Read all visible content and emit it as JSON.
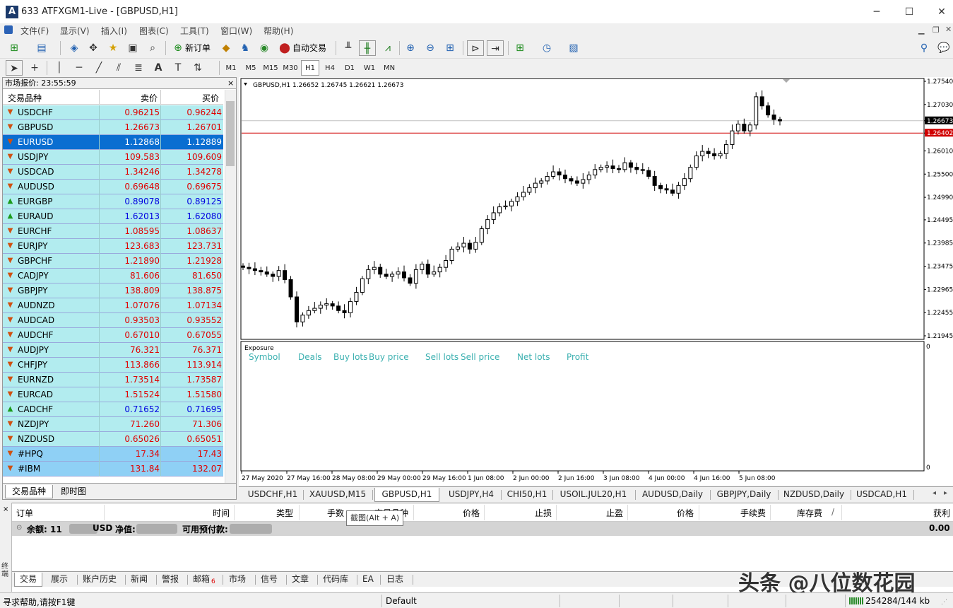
{
  "window": {
    "title": "633  ATFXGM1-Live - [GBPUSD,H1]",
    "min": "─",
    "max": "☐",
    "close": "✕"
  },
  "menu": [
    "文件(F)",
    "显示(V)",
    "插入(I)",
    "图表(C)",
    "工具(T)",
    "窗口(W)",
    "帮助(H)"
  ],
  "toolbar": {
    "new_order": "新订单",
    "auto_trade": "自动交易"
  },
  "timeframes": [
    "M1",
    "M5",
    "M15",
    "M30",
    "H1",
    "H4",
    "D1",
    "W1",
    "MN"
  ],
  "selected_timeframe": "H1",
  "market_watch": {
    "title": "市场报价: 23:55:59",
    "close": "×",
    "headers": {
      "symbol": "交易品种",
      "bid": "卖价",
      "ask": "买价"
    },
    "rows": [
      {
        "symbol": "USDCHF",
        "bid": "0.96215",
        "ask": "0.96244",
        "dir": "down",
        "color": "#e00000"
      },
      {
        "symbol": "GBPUSD",
        "bid": "1.26673",
        "ask": "1.26701",
        "dir": "down",
        "color": "#e00000"
      },
      {
        "symbol": "EURUSD",
        "bid": "1.12868",
        "ask": "1.12889",
        "dir": "down",
        "color": "#ffffff",
        "selected": true
      },
      {
        "symbol": "USDJPY",
        "bid": "109.583",
        "ask": "109.609",
        "dir": "down",
        "color": "#e00000"
      },
      {
        "symbol": "USDCAD",
        "bid": "1.34246",
        "ask": "1.34278",
        "dir": "down",
        "color": "#e00000"
      },
      {
        "symbol": "AUDUSD",
        "bid": "0.69648",
        "ask": "0.69675",
        "dir": "down",
        "color": "#e00000"
      },
      {
        "symbol": "EURGBP",
        "bid": "0.89078",
        "ask": "0.89125",
        "dir": "up",
        "color": "#0000e0"
      },
      {
        "symbol": "EURAUD",
        "bid": "1.62013",
        "ask": "1.62080",
        "dir": "up",
        "color": "#0000e0"
      },
      {
        "symbol": "EURCHF",
        "bid": "1.08595",
        "ask": "1.08637",
        "dir": "down",
        "color": "#e00000"
      },
      {
        "symbol": "EURJPY",
        "bid": "123.683",
        "ask": "123.731",
        "dir": "down",
        "color": "#e00000"
      },
      {
        "symbol": "GBPCHF",
        "bid": "1.21890",
        "ask": "1.21928",
        "dir": "down",
        "color": "#e00000"
      },
      {
        "symbol": "CADJPY",
        "bid": "81.606",
        "ask": "81.650",
        "dir": "down",
        "color": "#e00000"
      },
      {
        "symbol": "GBPJPY",
        "bid": "138.809",
        "ask": "138.875",
        "dir": "down",
        "color": "#e00000"
      },
      {
        "symbol": "AUDNZD",
        "bid": "1.07076",
        "ask": "1.07134",
        "dir": "down",
        "color": "#e00000"
      },
      {
        "symbol": "AUDCAD",
        "bid": "0.93503",
        "ask": "0.93552",
        "dir": "down",
        "color": "#e00000"
      },
      {
        "symbol": "AUDCHF",
        "bid": "0.67010",
        "ask": "0.67055",
        "dir": "down",
        "color": "#e00000"
      },
      {
        "symbol": "AUDJPY",
        "bid": "76.321",
        "ask": "76.371",
        "dir": "down",
        "color": "#e00000"
      },
      {
        "symbol": "CHFJPY",
        "bid": "113.866",
        "ask": "113.914",
        "dir": "down",
        "color": "#e00000"
      },
      {
        "symbol": "EURNZD",
        "bid": "1.73514",
        "ask": "1.73587",
        "dir": "down",
        "color": "#e00000"
      },
      {
        "symbol": "EURCAD",
        "bid": "1.51524",
        "ask": "1.51580",
        "dir": "down",
        "color": "#e00000"
      },
      {
        "symbol": "CADCHF",
        "bid": "0.71652",
        "ask": "0.71695",
        "dir": "up",
        "color": "#0000e0"
      },
      {
        "symbol": "NZDJPY",
        "bid": "71.260",
        "ask": "71.306",
        "dir": "down",
        "color": "#e00000"
      },
      {
        "symbol": "NZDUSD",
        "bid": "0.65026",
        "ask": "0.65051",
        "dir": "down",
        "color": "#e00000"
      },
      {
        "symbol": "#HPQ",
        "bid": "17.34",
        "ask": "17.43",
        "dir": "down",
        "color": "#e00000",
        "index": true
      },
      {
        "symbol": "#IBM",
        "bid": "131.84",
        "ask": "132.07",
        "dir": "down",
        "color": "#e00000",
        "index": true
      }
    ],
    "tabs": [
      "交易品种",
      "即时图"
    ]
  },
  "chart": {
    "header": "GBPUSD,H1  1.26652 1.26745 1.26621 1.26673",
    "price_labels": [
      "1.27540",
      "1.27030",
      "1.26673",
      "1.26402",
      "1.26010",
      "1.25500",
      "1.24990",
      "1.24495",
      "1.23985",
      "1.23475",
      "1.22965",
      "1.22455",
      "1.21945"
    ],
    "time_labels": [
      "27 May 2020",
      "27 May 16:00",
      "28 May 08:00",
      "29 May 00:00",
      "29 May 16:00",
      "1 Jun 08:00",
      "2 Jun 00:00",
      "2 Jun 16:00",
      "3 Jun 08:00",
      "4 Jun 00:00",
      "4 Jun 16:00",
      "5 Jun 08:00"
    ],
    "exposure": {
      "title": "Exposure",
      "columns": [
        "Symbol",
        "Deals",
        "Buy lots",
        "Buy price",
        "Sell lots",
        "Sell price",
        "Net lots",
        "Profit"
      ],
      "axis_top": "0",
      "axis_bottom": "0"
    }
  },
  "chart_data": {
    "type": "candlestick",
    "title": "GBPUSD,H1",
    "ylim": [
      1.21945,
      1.2754
    ],
    "bid_line": 1.26673,
    "red_line": 1.26402,
    "candles_close": [
      1.2345,
      1.2342,
      1.2338,
      1.2335,
      1.233,
      1.2325,
      1.2338,
      1.2318,
      1.228,
      1.2225,
      1.224,
      1.225,
      1.2255,
      1.2262,
      1.2265,
      1.226,
      1.225,
      1.2245,
      1.227,
      1.229,
      1.232,
      1.234,
      1.2345,
      1.233,
      1.2325,
      1.233,
      1.2335,
      1.2322,
      1.231,
      1.234,
      1.2352,
      1.233,
      1.2335,
      1.2345,
      1.236,
      1.2385,
      1.239,
      1.2398,
      1.2385,
      1.24,
      1.243,
      1.245,
      1.2465,
      1.2478,
      1.248,
      1.249,
      1.25,
      1.251,
      1.252,
      1.253,
      1.2535,
      1.2545,
      1.2555,
      1.2548,
      1.254,
      1.2535,
      1.253,
      1.2538,
      1.2548,
      1.256,
      1.2565,
      1.2568,
      1.2562,
      1.256,
      1.2575,
      1.2565,
      1.256,
      1.2558,
      1.2545,
      1.2525,
      1.2518,
      1.2515,
      1.2508,
      1.2525,
      1.254,
      1.2565,
      1.259,
      1.26,
      1.2595,
      1.259,
      1.2595,
      1.2615,
      1.2645,
      1.266,
      1.2645,
      1.2658,
      1.272,
      1.27,
      1.268,
      1.267,
      1.2667
    ]
  },
  "chart_tabs": [
    "USDCHF,H1",
    "XAUUSD,M15",
    "GBPUSD,H1",
    "USDJPY,H4",
    "CHI50,H1",
    "USOIL.JUL20,H1",
    "AUDUSD,Daily",
    "GBPJPY,Daily",
    "NZDUSD,Daily",
    "USDCAD,H1"
  ],
  "active_chart_tab": "GBPUSD,H1",
  "terminal": {
    "side_label": "终端",
    "columns": [
      "订单",
      "时间",
      "类型",
      "手数",
      "交易品种",
      "价格",
      "止损",
      "止盈",
      "价格",
      "手续费",
      "库存费",
      "/",
      "获利"
    ],
    "balance_label": "余额: 11",
    "balance_ccy": "USD",
    "equity_label": "净值:",
    "free_margin_label": "可用预付款:",
    "profit": "0.00",
    "tooltip": "截图(Alt + A)",
    "tabs": [
      "交易",
      "展示",
      "账户历史",
      "新闻",
      "警报",
      "邮箱",
      "市场",
      "信号",
      "文章",
      "代码库",
      "EA",
      "日志"
    ],
    "mail_count": "6"
  },
  "status": {
    "help": "寻求帮助,请按F1键",
    "profile": "Default",
    "traffic": "254284/144 kb"
  },
  "watermark": "头条 @八位数花园"
}
